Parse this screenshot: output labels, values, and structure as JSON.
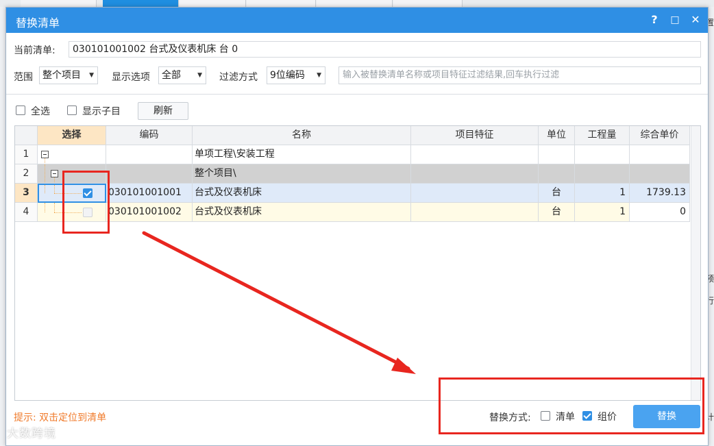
{
  "dialog": {
    "title": "替换清单",
    "help_label": "?",
    "maximize_label": "□",
    "close_label": "✕"
  },
  "current_list": {
    "label": "当前清单:",
    "value": "030101001002 台式及仪表机床 台 0"
  },
  "filters": {
    "scope_label": "范围",
    "scope_value": "整个项目",
    "display_label": "显示选项",
    "display_value": "全部",
    "filter_mode_label": "过滤方式",
    "filter_mode_value": "9位编码",
    "filter_placeholder": "输入被替换清单名称或项目特征过滤结果,回车执行过滤"
  },
  "toolbar": {
    "select_all_label": "全选",
    "show_children_label": "显示子目",
    "refresh_label": "刷新"
  },
  "grid": {
    "headers": [
      "选择",
      "编码",
      "名称",
      "项目特征",
      "单位",
      "工程量",
      "综合单价"
    ],
    "rows": [
      {
        "num": "1",
        "code": "",
        "name": "单项工程\\安装工程",
        "feature": "",
        "unit": "",
        "qty": "",
        "price": ""
      },
      {
        "num": "2",
        "code": "",
        "name": "整个项目\\",
        "feature": "",
        "unit": "",
        "qty": "",
        "price": ""
      },
      {
        "num": "3",
        "code": "030101001001",
        "name": "台式及仪表机床",
        "feature": "",
        "unit": "台",
        "qty": "1",
        "price": "1739.13",
        "checked": true
      },
      {
        "num": "4",
        "code": "030101001002",
        "name": "台式及仪表机床",
        "feature": "",
        "unit": "台",
        "qty": "1",
        "price": "0",
        "checked": false
      }
    ]
  },
  "footer": {
    "hint": "提示: 双击定位到清单",
    "replace_mode_label": "替换方式:",
    "option_list_label": "清单",
    "option_pricing_label": "组价",
    "option_list_checked": false,
    "option_pricing_checked": true,
    "replace_button": "替换"
  },
  "background": {
    "right_glyphs": [
      "置",
      "预",
      "行",
      "计"
    ]
  },
  "watermark": "大数跨境",
  "colors": {
    "title_bar": "#2f8fe4",
    "accent": "#2f8fe4",
    "hint": "#f07a2a",
    "annotation": "#e8261f"
  }
}
